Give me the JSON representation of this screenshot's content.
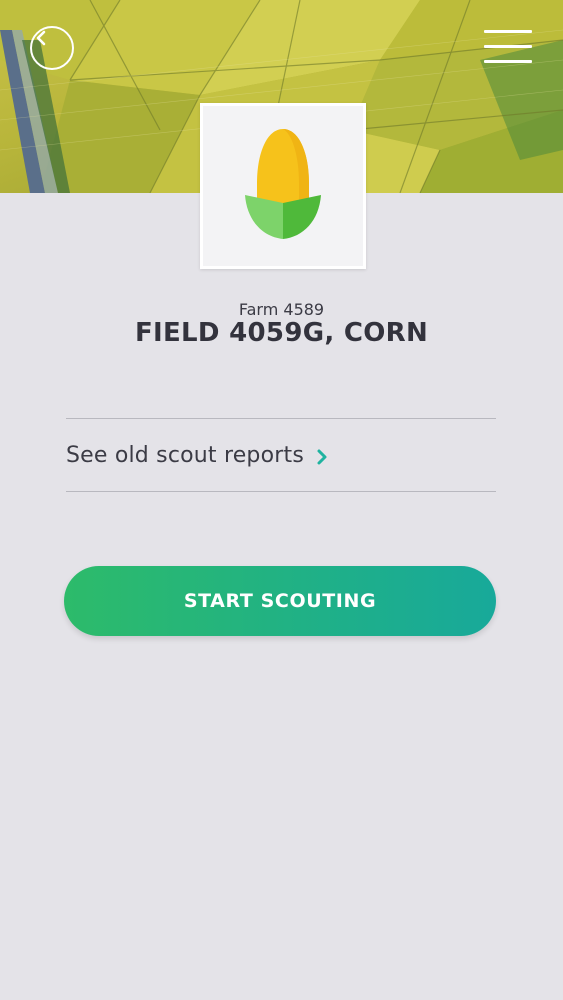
{
  "header": {
    "back_icon": "chevron-left-circle-icon",
    "menu_icon": "hamburger-menu-icon"
  },
  "crop": {
    "icon": "corn-icon",
    "colors": {
      "kernel": "#f6c21b",
      "husk_light": "#7dd36a",
      "husk_dark": "#4fb93a"
    }
  },
  "field": {
    "farm_name": "Farm 4589",
    "title": "FIELD 4059G, CORN"
  },
  "reports": {
    "link_label": "See old scout reports",
    "chevron_icon": "chevron-right-icon",
    "accent": "#1fb3a0"
  },
  "actions": {
    "start_label": "START SCOUTING"
  }
}
